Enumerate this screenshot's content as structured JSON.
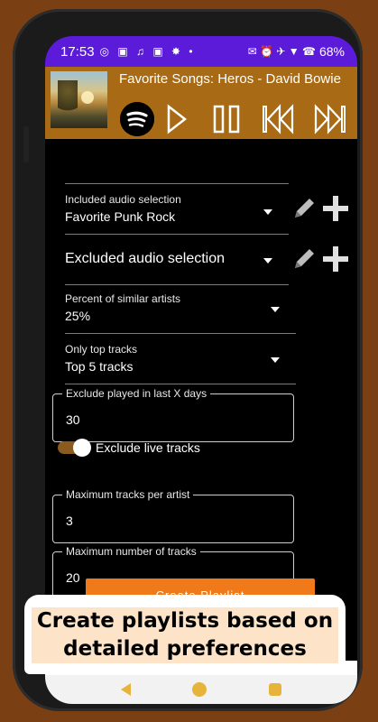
{
  "status_bar": {
    "time": "17:53",
    "left_icons": "◎ ▣ ♫ ▣ ✸ •",
    "right_icons": "✉ ⏰ ✈ ▼ ☎",
    "battery": "68%"
  },
  "player": {
    "song_title": "Favorite Songs: Heros - David Bowie",
    "controls": [
      "spotify-icon",
      "play-icon",
      "pause-icon",
      "previous-icon",
      "next-icon"
    ]
  },
  "form": {
    "included_audio": {
      "label": "Included audio selection",
      "value": "Favorite Punk Rock"
    },
    "excluded_audio": {
      "value": "Excluded audio selection"
    },
    "similar_artists": {
      "label": "Percent of similar artists",
      "value": "25%"
    },
    "top_tracks": {
      "label": "Only top tracks",
      "value": "Top 5 tracks"
    },
    "exclude_played": {
      "label": "Exclude played in last X days",
      "value": "30"
    },
    "exclude_live": {
      "label": "Exclude live tracks",
      "checked": true
    },
    "max_per_artist": {
      "label": "Maximum tracks per artist",
      "value": "3"
    },
    "max_tracks": {
      "label": "Maximum number of tracks",
      "value": "20"
    },
    "create_button": "Create Playlist"
  },
  "caption": "Create playlists based on detailed preferences",
  "colors": {
    "status_bar": "#5b1bd8",
    "player_bg": "#a86a14",
    "accent": "#f07a1a",
    "page_bg": "#7a3f12"
  }
}
